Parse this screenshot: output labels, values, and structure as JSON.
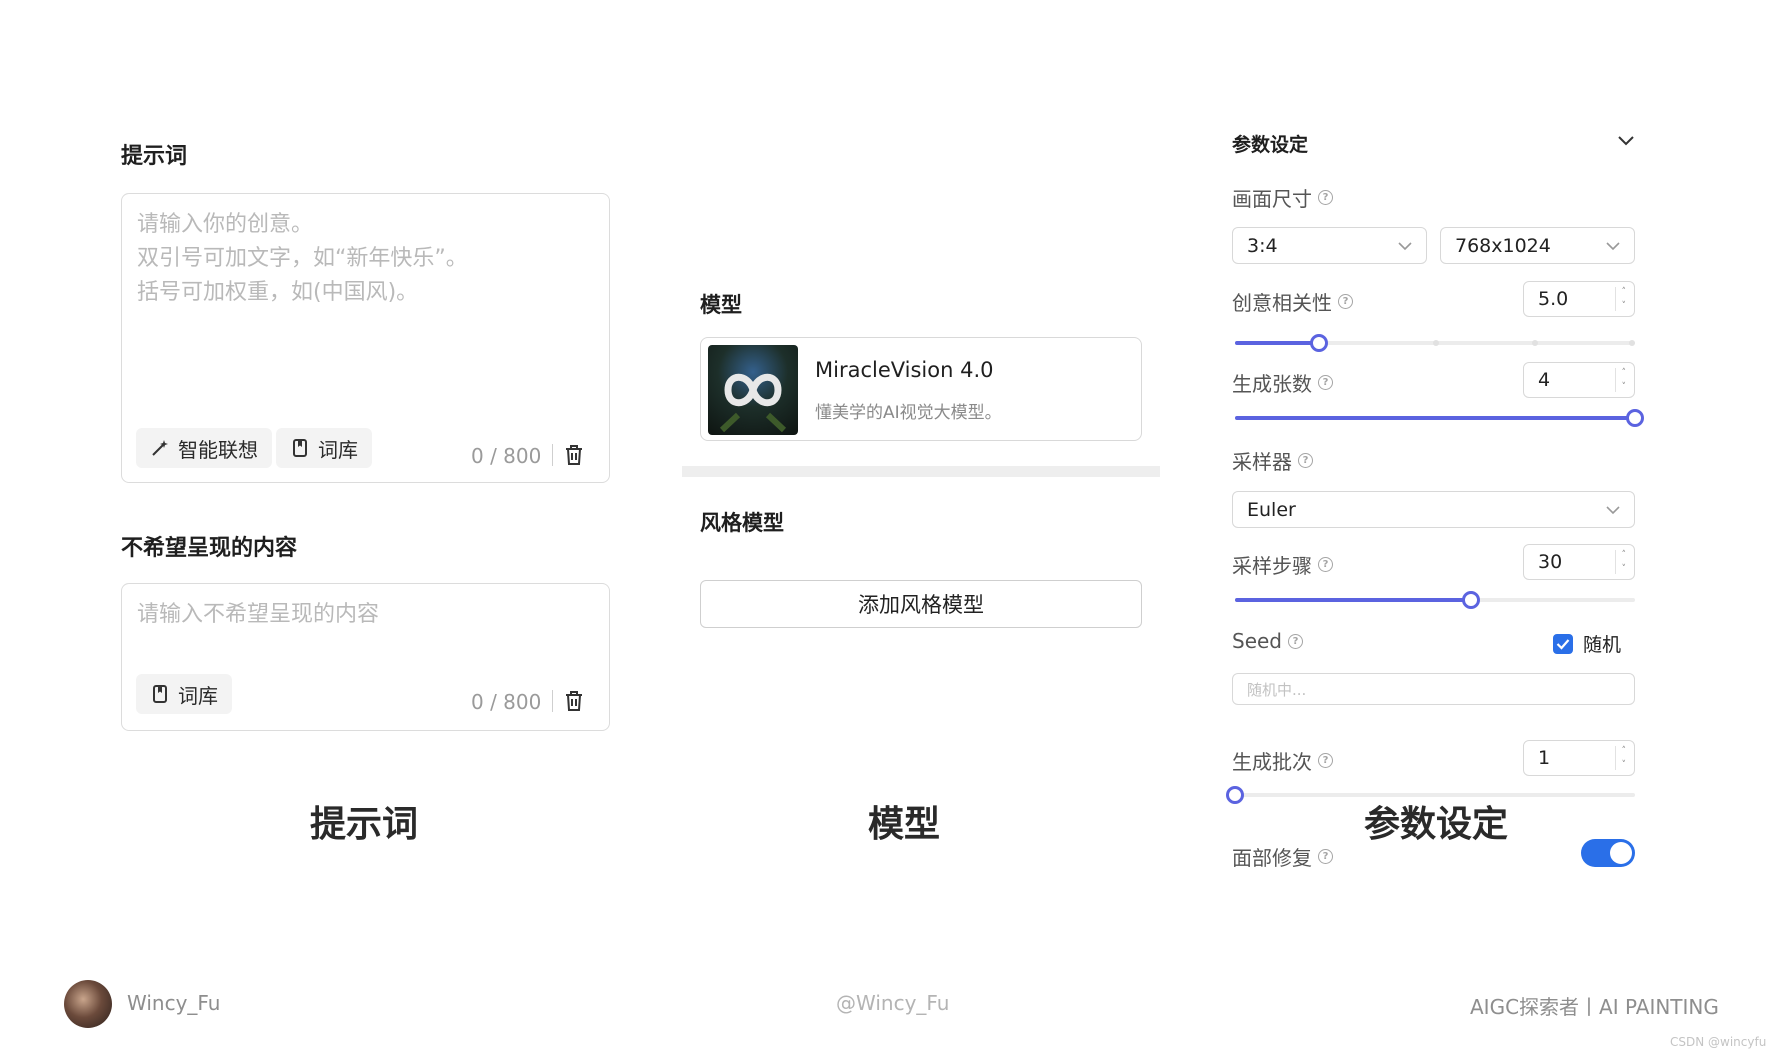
{
  "prompt_panel": {
    "title": "提示词",
    "placeholder": "请输入你的创意。\n双引号可加文字，如“新年快乐”。\n括号可加权重，如(中国风)。",
    "smart_btn": "智能联想",
    "library_btn": "词库",
    "counter": "0 / 800"
  },
  "negative_panel": {
    "title": "不希望呈现的内容",
    "placeholder": "请输入不希望呈现的内容",
    "library_btn": "词库",
    "counter": "0 / 800"
  },
  "model_panel": {
    "title": "模型",
    "model_name": "MiracleVision 4.0",
    "model_desc": "懂美学的AI视觉大模型。",
    "style_title": "风格模型",
    "add_style_btn": "添加风格模型"
  },
  "params": {
    "title": "参数设定",
    "size_label": "画面尺寸",
    "ratio": "3:4",
    "resolution": "768x1024",
    "creativity_label": "创意相关性",
    "creativity_value": "5.0",
    "creativity_fraction": 0.21,
    "count_label": "生成张数",
    "count_value": "4",
    "count_fraction": 1.0,
    "sampler_label": "采样器",
    "sampler_value": "Euler",
    "steps_label": "采样步骤",
    "steps_value": "30",
    "steps_fraction": 0.59,
    "seed_label": "Seed",
    "seed_random_label": "随机",
    "seed_random_checked": true,
    "seed_placeholder": "随机中...",
    "batch_label": "生成批次",
    "batch_value": "1",
    "batch_fraction": 0.0,
    "face_fix_label": "面部修复",
    "face_fix_on": true
  },
  "captions": {
    "prompt": "提示词",
    "model": "模型",
    "params": "参数设定"
  },
  "footer": {
    "author": "Wincy_Fu",
    "handle": "@Wincy_Fu",
    "tagline": "AIGC探索者丨AI PAINTING",
    "watermark": "CSDN @wincyfu"
  },
  "colors": {
    "accent": "#5b63e0",
    "check_blue": "#2a6fe8"
  }
}
